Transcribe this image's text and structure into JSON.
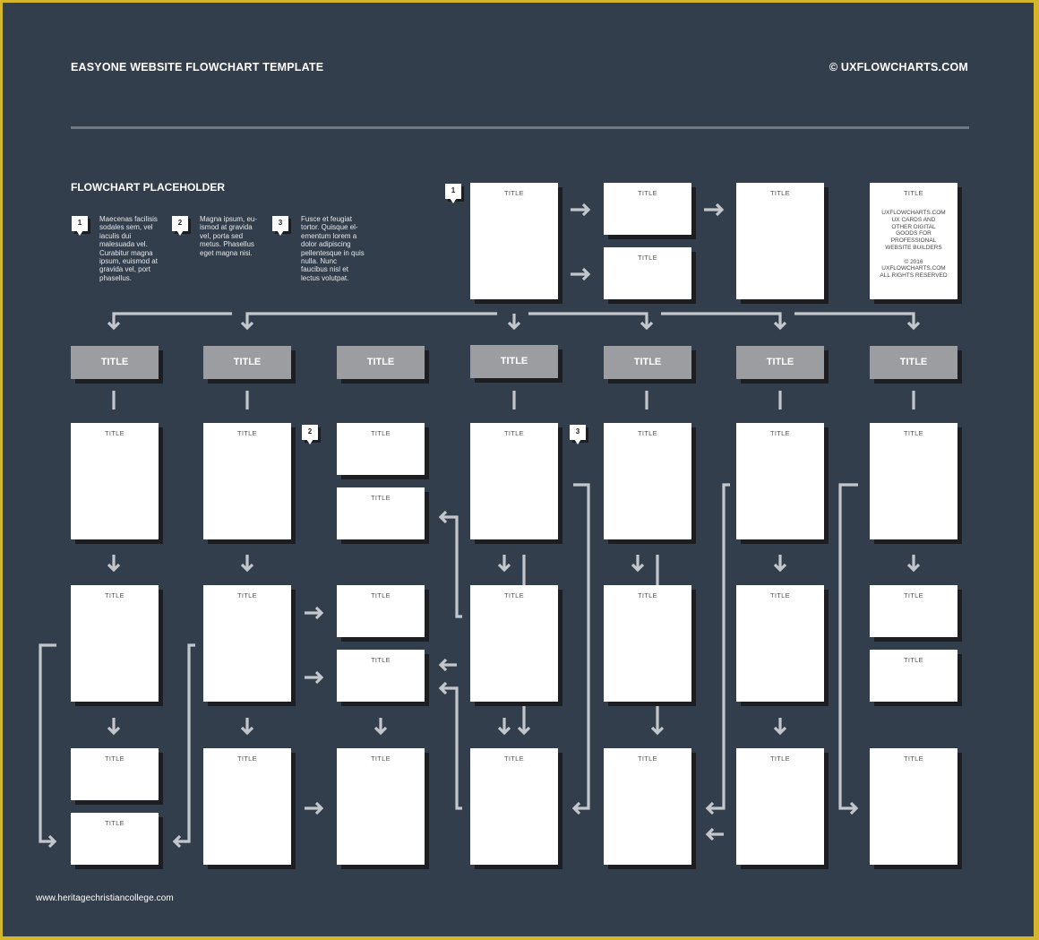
{
  "header": {
    "title": "EASYONE WEBSITE FLOWCHART TEMPLATE",
    "copyright": "© UXFLOWCHARTS.COM"
  },
  "legend": {
    "title": "FLOWCHART PLACEHOLDER",
    "notes": [
      {
        "number": "1",
        "text": "Maecenas facilisis sodales sem, vel iaculis dui malesuada vel. Curabitur magna ipsum, euismod at gravida vel, port phasellus."
      },
      {
        "number": "2",
        "text": "Magna ipsum, eu-ismod at gravida vel, porta sed metus. Phasellus eget magna nisi."
      },
      {
        "number": "3",
        "text": "Fusce et feugiat tortor. Quisque el-ementum lorem a dolor adipiscing pellentesque in quis nulla. Nunc faucibus nisl et lectus volutpat."
      }
    ]
  },
  "markers": [
    "1",
    "2",
    "3"
  ],
  "card_title": "TITLE",
  "info_card": {
    "title": "TITLE",
    "body": "UXFLOWCHARTS.COM\nUX CARDS AND\nOTHER DIGITAL\nGOODS FOR\nPROFESSIONAL\nWEBSITE BUILDERS\n\n© 2016\nUXFLOWCHARTS.COM\nALL RIGHTS RESERVED"
  },
  "sections": [
    {
      "title": "TITLE"
    },
    {
      "title": "TITLE"
    },
    {
      "title": "TITLE"
    },
    {
      "title": "TITLE"
    },
    {
      "title": "TITLE"
    },
    {
      "title": "TITLE"
    },
    {
      "title": "TITLE"
    }
  ],
  "colors": {
    "background": "#333e4c",
    "border": "#d4b62a",
    "card": "#ffffff",
    "section_card": "#9c9da1",
    "connector": "#c3c6cb"
  },
  "footer": {
    "watermark": "www.heritagechristiancollege.com"
  }
}
